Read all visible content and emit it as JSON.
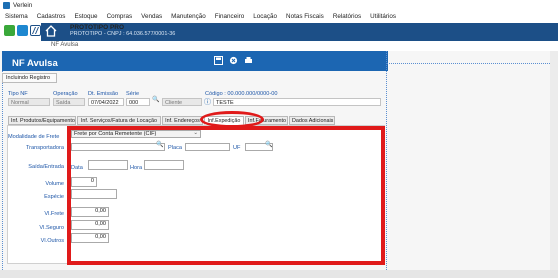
{
  "window": {
    "title": "Verlein"
  },
  "menu": [
    "Sistema",
    "Cadastros",
    "Estoque",
    "Compras",
    "Vendas",
    "Manutenção",
    "Financeiro",
    "Locação",
    "Notas Fiscais",
    "Relatórios",
    "Utilitários"
  ],
  "banner": {
    "line1": "PROTOTIPO PRO",
    "line2": "PROTOTIPO - CNPJ : 64.036.577/0001-36"
  },
  "doc_tab": "NF Avulsa",
  "form": {
    "title": "NF Avulsa",
    "subtitle": "Incluindo Registro"
  },
  "fields": {
    "tipo_nf": {
      "label": "Tipo NF",
      "value": "Normal"
    },
    "operacao": {
      "label": "Operação",
      "value": "Saída"
    },
    "dt_emissao": {
      "label": "Dt. Emissão",
      "value": "07/04/2022"
    },
    "serie": {
      "label": "Série",
      "value": "000"
    },
    "cliente": {
      "label": "Cliente",
      "value": ""
    },
    "codigo": {
      "label": "Código : 00.000.000/0000-00",
      "value": "TESTE"
    }
  },
  "tabs": [
    "Inf. Produtos/Equipamentos",
    "Inf. Serviços/Fatura de Locação",
    "Inf. Endereços",
    "Inf.Expedição",
    "Inf.Faturamento",
    "Dados Adicionais"
  ],
  "expedicao": {
    "modalidade_label": "Modalidade de Frete",
    "modalidade_value": "Frete por Conta Remetente (CIF)",
    "transportadora_label": "Transportadora",
    "placa_label": "Placa",
    "uf_label": "UF",
    "saida_label": "Saída/Entrada",
    "data_label": "Data",
    "hora_label": "Hora",
    "volume_label": "Volume",
    "volume_value": "0",
    "especie_label": "Espécie",
    "vl_frete_label": "Vl.Frete",
    "vl_frete_value": "0,00",
    "vl_seguro_label": "Vl.Seguro",
    "vl_seguro_value": "0,00",
    "vl_outros_label": "Vl.Outros",
    "vl_outros_value": "0,00"
  }
}
